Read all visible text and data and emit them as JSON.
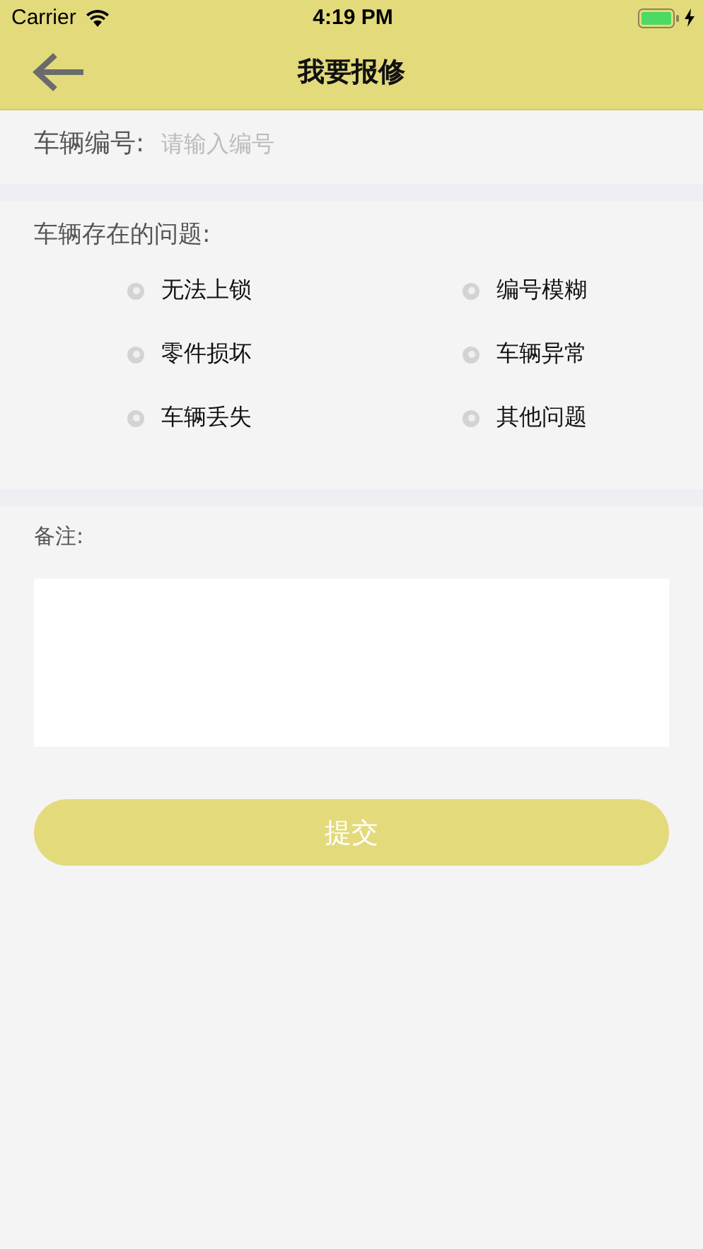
{
  "status_bar": {
    "carrier": "Carrier",
    "time": "4:19 PM"
  },
  "nav": {
    "title": "我要报修"
  },
  "vehicle_number": {
    "label": "车辆编号:",
    "placeholder": "请输入编号"
  },
  "problems": {
    "label": "车辆存在的问题:",
    "options": [
      {
        "label": "无法上锁",
        "selected": false
      },
      {
        "label": "编号模糊",
        "selected": false
      },
      {
        "label": "零件损坏",
        "selected": false
      },
      {
        "label": "车辆异常",
        "selected": false
      },
      {
        "label": "车辆丢失",
        "selected": false
      },
      {
        "label": "其他问题",
        "selected": false
      }
    ]
  },
  "remarks": {
    "label": "备注:"
  },
  "submit": {
    "label": "提交"
  }
}
